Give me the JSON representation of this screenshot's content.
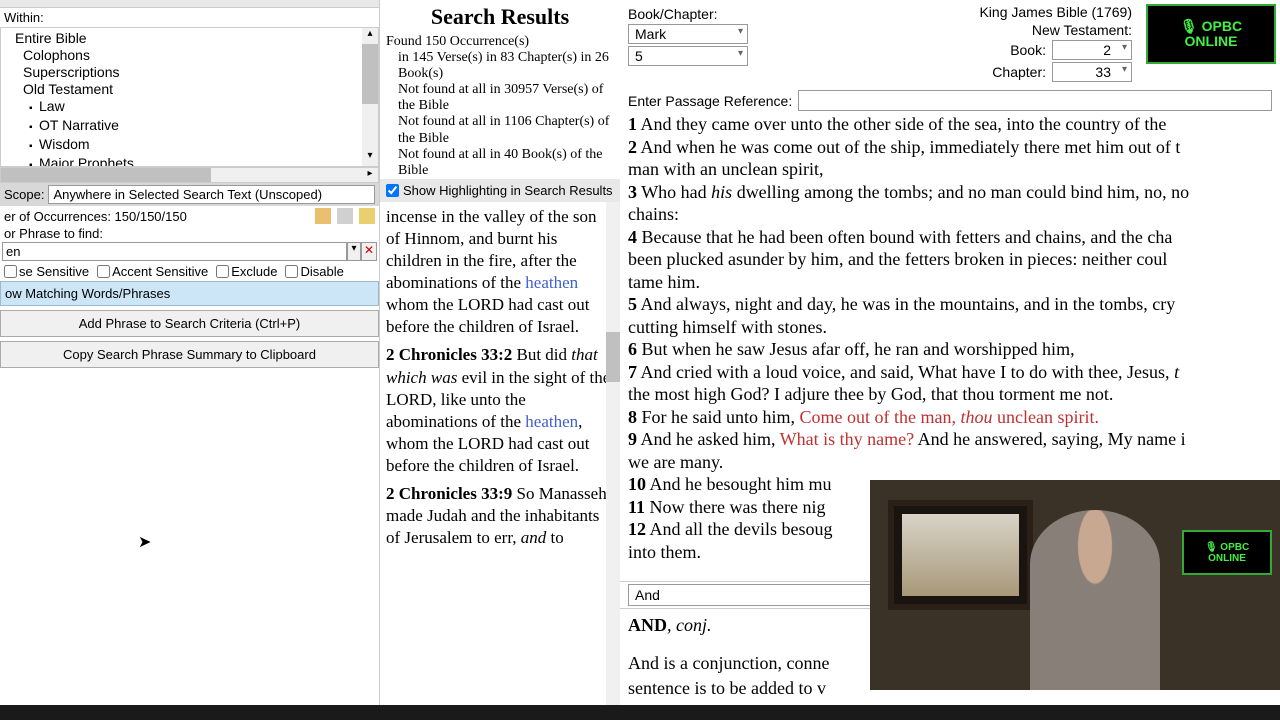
{
  "left": {
    "within_label": "Within:",
    "tree": [
      {
        "level": 0,
        "exp": "",
        "text": "Entire Bible"
      },
      {
        "level": 1,
        "exp": "",
        "text": "Colophons"
      },
      {
        "level": 1,
        "exp": "",
        "text": "Superscriptions"
      },
      {
        "level": 1,
        "exp": "",
        "text": "Old Testament"
      },
      {
        "level": 2,
        "exp": "▪",
        "text": "Law"
      },
      {
        "level": 2,
        "exp": "▪",
        "text": "OT Narrative"
      },
      {
        "level": 2,
        "exp": "▪",
        "text": "Wisdom"
      },
      {
        "level": 2,
        "exp": "▪",
        "text": "Major Prophets"
      }
    ],
    "scope_label": "Scope:",
    "scope_value": "Anywhere in Selected Search Text (Unscoped)",
    "occ_label": "er of Occurrences: 150/150/150",
    "phrase_label": "or Phrase to find:",
    "phrase_value": "en",
    "case_sensitive": "se Sensitive",
    "accent_sensitive": "Accent Sensitive",
    "exclude": "Exclude",
    "disable": "Disable",
    "matching": "ow Matching Words/Phrases",
    "add_phrase": "Add Phrase to Search Criteria (Ctrl+P)",
    "copy_summary": "Copy Search Phrase Summary to Clipboard"
  },
  "mid": {
    "title": "Search Results",
    "found": "Found 150 Occurrence(s)",
    "in_verses": "in 145 Verse(s) in 83 Chapter(s) in 26 Book(s)",
    "not_verses": "Not found at all in 30957 Verse(s) of the Bible",
    "not_chapters": "Not found at all in 1106 Chapter(s) of the Bible",
    "not_books": "Not found at all in 40 Book(s) of the Bible",
    "highlight_label": "Show Highlighting in Search Results",
    "r1_pre": "incense in the valley of the son of Hinnom, and burnt his children in the fire, after the abominations of the ",
    "r1_link": "heathen",
    "r1_post": " whom the LORD had cast out before the children of Israel.",
    "r2_ref": "2 Chronicles 33:2",
    "r2_a": " But did ",
    "r2_i": "that which was",
    "r2_b": " evil in the sight of the LORD, like unto the abominations of the ",
    "r2_link": "heathen",
    "r2_c": ", whom the LORD had cast out before the children of Israel.",
    "r3_ref": "2 Chronicles 33:9",
    "r3_a": " So Manasseh made Judah and the inhabitants of Jerusalem to err, ",
    "r3_i": "and",
    "r3_b": " to"
  },
  "right": {
    "version": "King James Bible (1769)",
    "bc_label": "Book/Chapter:",
    "nt_label": "New Testament:",
    "book_label": "Book:",
    "chapter_label": "Chapter:",
    "book_combo": "Mark",
    "chap_combo": "5",
    "book_num": "2",
    "chap_num": "33",
    "passage_label": "Enter Passage Reference:",
    "logo": "🎙 OPBC\nONLINE",
    "verses": {
      "v1": "And they came over unto the other side of the sea, into the country of the",
      "v2": "And when he was come out of the ship, immediately there met him out of t",
      "v2b": "man with an unclean spirit,",
      "v3a": "Who had ",
      "v3i": "his",
      "v3b": " dwelling among the tombs; and no man could bind him, no, no",
      "v3c": "chains:",
      "v4a": "Because that he had been often bound with fetters and chains, and the cha",
      "v4b": "been plucked asunder by him, and the fetters broken in pieces: neither coul",
      "v4c": "tame him.",
      "v5a": "And always, night and day, he was in the mountains, and in the tombs, cry",
      "v5b": "cutting himself with stones.",
      "v6": "But when he saw Jesus afar off, he ran and worshipped him,",
      "v7a": "And cried with a loud voice, and said, What have I to do with thee, Jesus, ",
      "v7i": "t",
      "v7b": "the most high God? I adjure thee by God, that thou torment me not.",
      "v8a": "For he said unto him, ",
      "v8r1": "Come out of the man, ",
      "v8ri": "thou",
      "v8r2": " unclean spirit.",
      "v9a": "And he asked him, ",
      "v9r": "What is thy name?",
      "v9b": " And he answered, saying, My name i",
      "v9c": "we are many.",
      "v10": "And he besought him mu",
      "v11": "Now there was there nig",
      "v12a": "And all the devils besoug",
      "v12b": "into them."
    },
    "dict": {
      "search": "And",
      "head": "AND",
      "pos": ", conj.",
      "body": "And is a conjunction, conne",
      "body2": "sentence is to be added to v"
    }
  }
}
